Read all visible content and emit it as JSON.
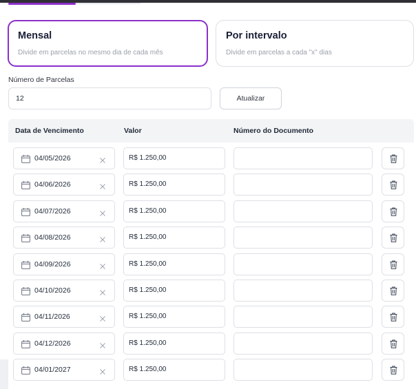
{
  "colors": {
    "accent": "#8b2fc9",
    "border": "#dcdfe4",
    "header_bg": "#f3f4f6"
  },
  "modes": [
    {
      "title": "Mensal",
      "description": "Divide em parcelas no mesmo dia de cada mês",
      "selected": true
    },
    {
      "title": "Por intervalo",
      "description": "Divide em parcelas a cada \"x\" dias",
      "selected": false
    }
  ],
  "installments": {
    "label": "Número de Parcelas",
    "value": "12",
    "update_label": "Atualizar"
  },
  "table": {
    "columns": [
      "Data de Vencimento",
      "Valor",
      "Número do Documento"
    ],
    "rows": [
      {
        "date": "04/05/2026",
        "value": "R$ 1.250,00",
        "document": ""
      },
      {
        "date": "04/06/2026",
        "value": "R$ 1.250,00",
        "document": ""
      },
      {
        "date": "04/07/2026",
        "value": "R$ 1.250,00",
        "document": ""
      },
      {
        "date": "04/08/2026",
        "value": "R$ 1.250,00",
        "document": ""
      },
      {
        "date": "04/09/2026",
        "value": "R$ 1.250,00",
        "document": ""
      },
      {
        "date": "04/10/2026",
        "value": "R$ 1.250,00",
        "document": ""
      },
      {
        "date": "04/11/2026",
        "value": "R$ 1.250,00",
        "document": ""
      },
      {
        "date": "04/12/2026",
        "value": "R$ 1.250,00",
        "document": ""
      },
      {
        "date": "04/01/2027",
        "value": "R$ 1.250,00",
        "document": ""
      }
    ]
  },
  "icons": {
    "date": "calendar-icon",
    "clear": "close-icon",
    "delete": "trash-icon"
  }
}
